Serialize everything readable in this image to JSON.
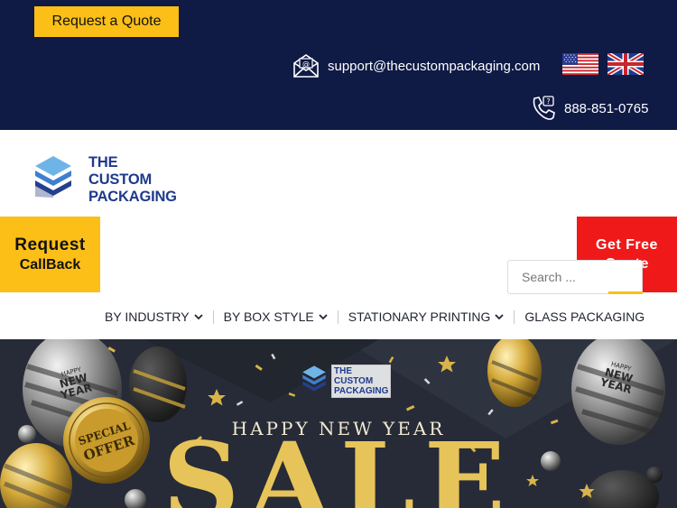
{
  "topbar": {
    "quote_button": "Request a Quote",
    "email": "support@thecustompackaging.com",
    "phone": "888-851-0765",
    "flags": [
      "us-flag",
      "uk-flag"
    ]
  },
  "logo": {
    "line1": "THE",
    "line2": "CUSTOM",
    "line3": "PACKAGING"
  },
  "callback": {
    "line1": "Request",
    "line2": "CallBack"
  },
  "free_quote": {
    "line1": "Get Free",
    "line2": "Quote"
  },
  "search": {
    "placeholder": "Search ..."
  },
  "nav": {
    "items": [
      {
        "label": "BY INDUSTRY",
        "dropdown": true
      },
      {
        "label": "BY BOX STYLE",
        "dropdown": true
      },
      {
        "label": "STATIONARY PRINTING",
        "dropdown": true
      },
      {
        "label": "GLASS PACKAGING",
        "dropdown": false
      }
    ]
  },
  "banner": {
    "logo_line1": "THE",
    "logo_line2": "CUSTOM",
    "logo_line3": "PACKAGING",
    "heading": "HAPPY NEW YEAR",
    "sale": "SALE",
    "badge_line1": "SPECIAL",
    "badge_line2": "OFFER",
    "balloon_text1": "HAPPY",
    "balloon_text2": "NEW",
    "balloon_text3": "YEAR"
  },
  "colors": {
    "navy": "#0f1a45",
    "yellow": "#fbbf18",
    "red": "#ef1919",
    "brand_blue": "#1f3a8c",
    "gold": "#e6c45a"
  }
}
